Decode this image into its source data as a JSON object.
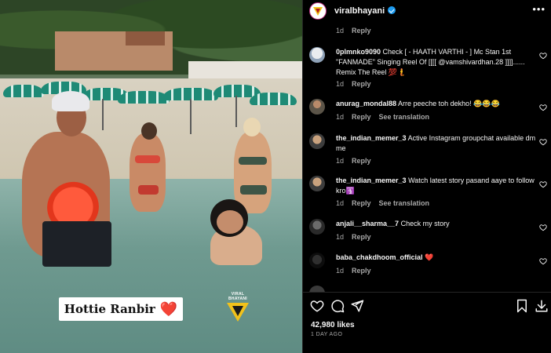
{
  "post": {
    "caption_chip_text": "Hottie Ranbir",
    "caption_chip_emoji": "❤️",
    "watermark_text": "VIRAL BHAYANI"
  },
  "header": {
    "username": "viralbhayani",
    "verified": true,
    "more_icon": "more-horizontal-icon"
  },
  "comments": [
    {
      "id": "top-partial",
      "time": "1d",
      "reply_label": "Reply"
    },
    {
      "username": "0plmnko9090",
      "text": "Check [ - HAATH VARTHI - ] Mc Stan 1st \"FANMADE\" Singing Reel Of [[[[ @vamshivardhan.28 ]]]]...... Remix The Reel 💯🧜",
      "time": "1d",
      "reply_label": "Reply",
      "see_translation": ""
    },
    {
      "username": "anurag_mondal88",
      "text": "Arre peeche toh dekho! 😂😂😂",
      "time": "1d",
      "reply_label": "Reply",
      "see_translation": "See translation"
    },
    {
      "username": "the_indian_memer_3",
      "text": "Active Instagram groupchat available dm me",
      "time": "1d",
      "reply_label": "Reply",
      "see_translation": ""
    },
    {
      "username": "the_indian_memer_3",
      "text": "Watch latest story pasand aaye to follow kro🛐",
      "time": "1d",
      "reply_label": "Reply",
      "see_translation": "See translation"
    },
    {
      "username": "anjali__sharma__7",
      "text": "Check my story",
      "time": "1d",
      "reply_label": "Reply",
      "see_translation": ""
    },
    {
      "username": "baba_chakdhoom_official",
      "text": "❤️",
      "time": "1d",
      "reply_label": "Reply",
      "see_translation": ""
    }
  ],
  "actions": {
    "likes": "42,980 likes",
    "posted_ago": "1 DAY AGO",
    "icons": [
      "heart-icon",
      "comment-icon",
      "share-icon",
      "bookmark-icon",
      "download-icon"
    ]
  },
  "colors": {
    "background": "#000000",
    "text_primary": "#f5f5f5",
    "text_secondary": "#a8a8a8",
    "verified_blue": "#1d9bf0",
    "divider": "#262626"
  }
}
